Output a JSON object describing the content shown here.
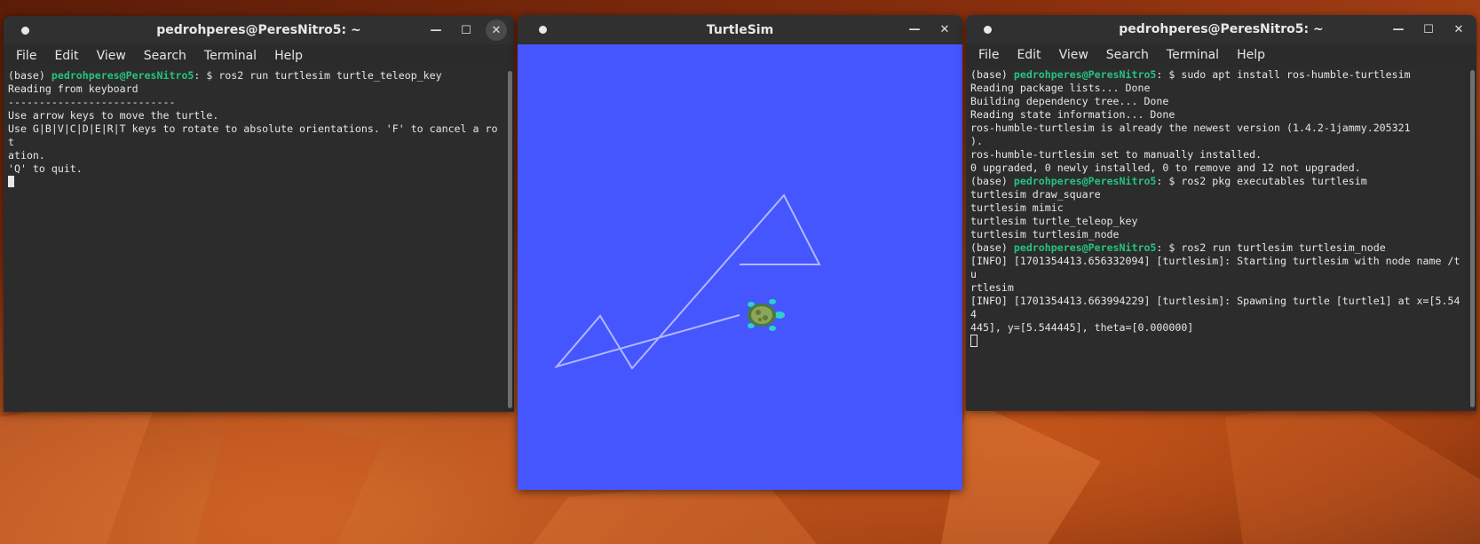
{
  "left_terminal": {
    "title": "pedrohperes@PeresNitro5: ~",
    "menu": [
      "File",
      "Edit",
      "View",
      "Search",
      "Terminal",
      "Help"
    ],
    "lines": [
      {
        "prefix": "(base) ",
        "user": "pedrohperes@PeresNitro5",
        "rest": ": $ ros2 run turtlesim turtle_teleop_key"
      },
      {
        "text": "Reading from keyboard"
      },
      {
        "text": "---------------------------"
      },
      {
        "text": "Use arrow keys to move the turtle."
      },
      {
        "text": "Use G|B|V|C|D|E|R|T keys to rotate to absolute orientations. 'F' to cancel a rot"
      },
      {
        "text": "ation."
      },
      {
        "text": "'Q' to quit."
      }
    ]
  },
  "turtlesim": {
    "title": "TurtleSim",
    "background_color": "#4556ff",
    "trail_color": "#b3b8ff",
    "turtle_icon": "turtle-icon"
  },
  "right_terminal": {
    "title": "pedrohperes@PeresNitro5: ~",
    "menu": [
      "File",
      "Edit",
      "View",
      "Search",
      "Terminal",
      "Help"
    ],
    "lines": [
      {
        "prefix": "(base) ",
        "user": "pedrohperes@PeresNitro5",
        "rest": ": $ sudo apt install ros-humble-turtlesim"
      },
      {
        "text": "Reading package lists... Done"
      },
      {
        "text": "Building dependency tree... Done"
      },
      {
        "text": "Reading state information... Done"
      },
      {
        "text": "ros-humble-turtlesim is already the newest version (1.4.2-1jammy.205321"
      },
      {
        "text": ")."
      },
      {
        "text": "ros-humble-turtlesim set to manually installed."
      },
      {
        "text": "0 upgraded, 0 newly installed, 0 to remove and 12 not upgraded."
      },
      {
        "prefix": "(base) ",
        "user": "pedrohperes@PeresNitro5",
        "rest": ": $ ros2 pkg executables turtlesim"
      },
      {
        "text": "turtlesim draw_square"
      },
      {
        "text": "turtlesim mimic"
      },
      {
        "text": "turtlesim turtle_teleop_key"
      },
      {
        "text": "turtlesim turtlesim_node"
      },
      {
        "prefix": "(base) ",
        "user": "pedrohperes@PeresNitro5",
        "rest": ": $ ros2 run turtlesim turtlesim_node"
      },
      {
        "text": "[INFO] [1701354413.656332094] [turtlesim]: Starting turtlesim with node name /tu"
      },
      {
        "text": "rtlesim"
      },
      {
        "text": "[INFO] [1701354413.663994229] [turtlesim]: Spawning turtle [turtle1] at x=[5.544"
      },
      {
        "text": "445], y=[5.544445], theta=[0.000000]"
      }
    ]
  }
}
